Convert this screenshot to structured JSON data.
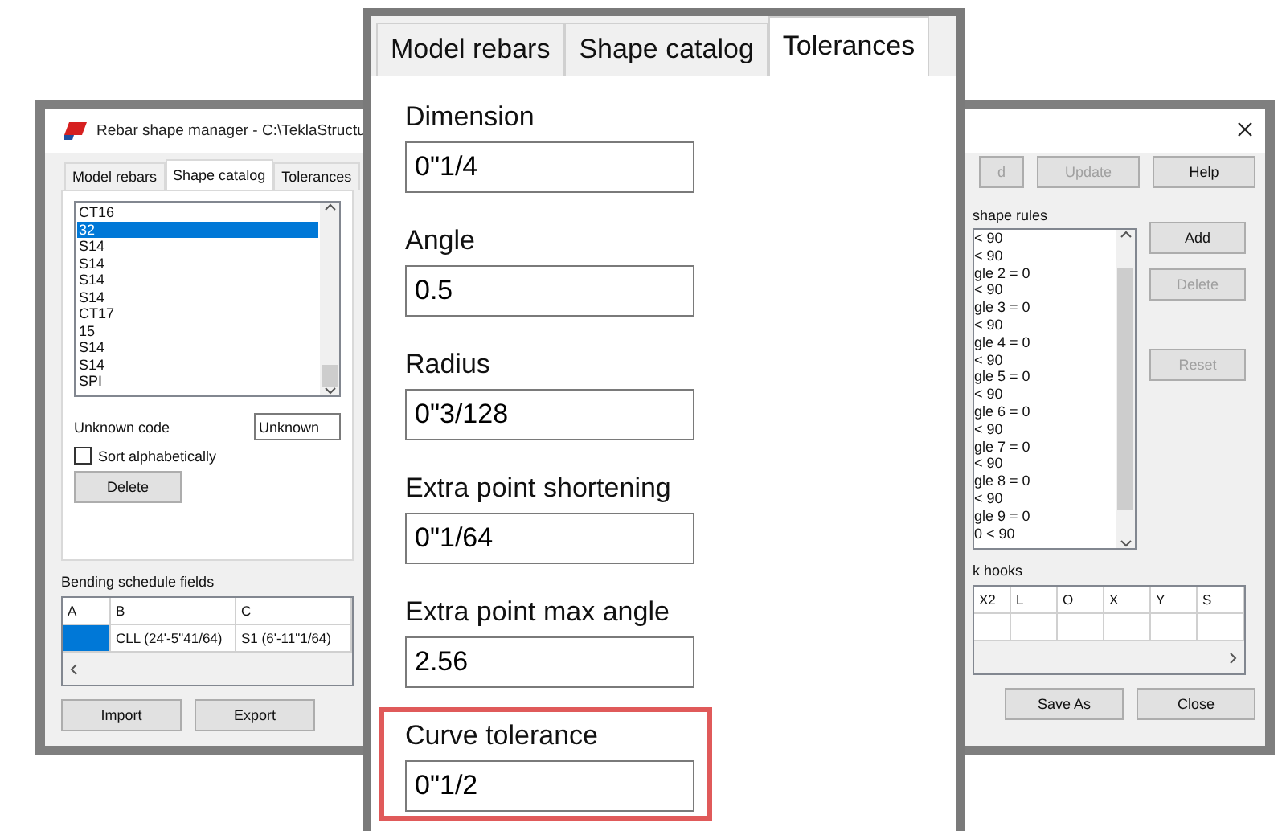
{
  "window": {
    "title": "Rebar shape manager - C:\\TeklaStructu",
    "tabs": [
      {
        "label": "Model rebars",
        "selected": false
      },
      {
        "label": "Shape catalog",
        "selected": true
      },
      {
        "label": "Tolerances",
        "selected": false
      }
    ],
    "shape_list": [
      {
        "label": "CT16",
        "selected": false
      },
      {
        "label": "32",
        "selected": true
      },
      {
        "label": "S14",
        "selected": false
      },
      {
        "label": "S14",
        "selected": false
      },
      {
        "label": "S14",
        "selected": false
      },
      {
        "label": "S14",
        "selected": false
      },
      {
        "label": "CT17",
        "selected": false
      },
      {
        "label": "15",
        "selected": false
      },
      {
        "label": "S14",
        "selected": false
      },
      {
        "label": "S14",
        "selected": false
      },
      {
        "label": "SPI",
        "selected": false
      }
    ],
    "unknown_code": {
      "label": "Unknown code",
      "value": "Unknown"
    },
    "sort_alphabetically": {
      "label": "Sort alphabetically",
      "checked": false
    },
    "delete_button": "Delete",
    "bending_schedule": {
      "label": "Bending schedule fields",
      "columns": [
        "A",
        "B",
        "C"
      ],
      "rows": [
        {
          "cells": [
            {
              "text": "",
              "selected": true
            },
            {
              "text": "CLL (24'-5\"41/64)",
              "selected": false
            },
            {
              "text": "S1 (6'-11\"1/64)",
              "selected": false
            }
          ]
        }
      ]
    },
    "left_buttons": [
      "Import",
      "Export"
    ],
    "top_buttons": [
      {
        "label": "d",
        "disabled": true
      },
      {
        "label": "Update",
        "disabled": true
      },
      {
        "label": "Help",
        "disabled": false
      }
    ],
    "shape_rules": {
      "label": "shape rules",
      "lines": [
        "< 90",
        "< 90",
        "gle 2 = 0",
        "< 90",
        "gle 3 = 0",
        "< 90",
        "gle 4 = 0",
        "< 90",
        "gle 5 = 0",
        "< 90",
        "gle 6 = 0",
        "< 90",
        "gle 7 = 0",
        "< 90",
        "gle 8 = 0",
        "< 90",
        "gle 9 = 0",
        "0 < 90"
      ]
    },
    "rule_buttons": [
      {
        "label": "Add",
        "disabled": false
      },
      {
        "label": "Delete",
        "disabled": true
      },
      {
        "label": "Reset",
        "disabled": true
      }
    ],
    "hooks": {
      "label": "k hooks",
      "columns": [
        "X2",
        "L",
        "O",
        "X",
        "Y",
        "S"
      ]
    },
    "right_buttons": [
      "Save As",
      "Close"
    ]
  },
  "callout": {
    "tabs": [
      {
        "label": "Model rebars",
        "selected": false
      },
      {
        "label": "Shape catalog",
        "selected": false
      },
      {
        "label": "Tolerances",
        "selected": true
      }
    ],
    "fields": [
      {
        "label": "Dimension",
        "value": "0\"1/4",
        "highlighted": false
      },
      {
        "label": "Angle",
        "value": "0.5",
        "highlighted": false
      },
      {
        "label": "Radius",
        "value": "0\"3/128",
        "highlighted": false
      },
      {
        "label": "Extra point shortening",
        "value": "0\"1/64",
        "highlighted": false
      },
      {
        "label": "Extra point max angle",
        "value": "2.56",
        "highlighted": false
      },
      {
        "label": "Curve tolerance",
        "value": "0\"1/2",
        "highlighted": true
      }
    ]
  }
}
